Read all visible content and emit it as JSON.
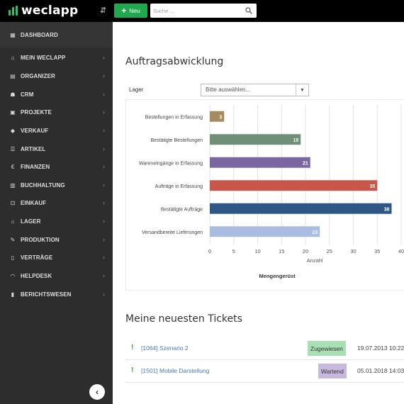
{
  "app": {
    "logo_text": "weclapp",
    "new_button_label": "Neu",
    "search_placeholder": "Suche ..."
  },
  "sidebar": {
    "items": [
      {
        "label": "DASHBOARD",
        "icon": "dashboard-icon",
        "has_chevron": false
      },
      {
        "label": "MEIN WECLAPP",
        "icon": "home-icon",
        "has_chevron": true
      },
      {
        "label": "ORGANIZER",
        "icon": "organizer-icon",
        "has_chevron": true
      },
      {
        "label": "CRM",
        "icon": "crm-icon",
        "has_chevron": true
      },
      {
        "label": "PROJEKTE",
        "icon": "briefcase-icon",
        "has_chevron": true
      },
      {
        "label": "VERKAUF",
        "icon": "tag-icon",
        "has_chevron": true
      },
      {
        "label": "ARTIKEL",
        "icon": "list-icon",
        "has_chevron": true
      },
      {
        "label": "FINANZEN",
        "icon": "euro-icon",
        "has_chevron": true
      },
      {
        "label": "BUCHHALTUNG",
        "icon": "calculator-icon",
        "has_chevron": true
      },
      {
        "label": "EINKAUF",
        "icon": "cart-icon",
        "has_chevron": true
      },
      {
        "label": "LAGER",
        "icon": "warehouse-icon",
        "has_chevron": true
      },
      {
        "label": "PRODUKTION",
        "icon": "wrench-icon",
        "has_chevron": true
      },
      {
        "label": "VERTRÄGE",
        "icon": "document-icon",
        "has_chevron": true
      },
      {
        "label": "HELPDESK",
        "icon": "headset-icon",
        "has_chevron": true
      },
      {
        "label": "BERICHTSWESEN",
        "icon": "bar-chart-icon",
        "has_chevron": true
      }
    ]
  },
  "order_processing": {
    "title": "Auftragsabwicklung",
    "lager_label": "Lager",
    "lager_select_value": "Bitte auswählen..."
  },
  "chart_data": {
    "type": "bar",
    "orientation": "horizontal",
    "categories": [
      "Bestellungen in Erfassung",
      "Bestätigte Bestellungen",
      "Wareneingänge in Erfassung",
      "Aufträge in Erfassung",
      "Bestätigte Aufträge",
      "Versandbereite Lieferungen"
    ],
    "values": [
      3,
      19,
      21,
      35,
      38,
      23
    ],
    "colors": [
      "#a48c62",
      "#6f8f76",
      "#7b67a0",
      "#c8564b",
      "#2f5785",
      "#a9bde0"
    ],
    "xticks": [
      0,
      5,
      10,
      15,
      20,
      25,
      30,
      35,
      40
    ],
    "xlim": [
      0,
      40
    ],
    "xlabel": "Anzahl",
    "title": "Mengengerüst",
    "grid": true,
    "data_labels": true
  },
  "tickets": {
    "title": "Meine neuesten Tickets",
    "items": [
      {
        "title": "[1064] Szenario 2",
        "status": "Zugewiesen",
        "status_color": "#a8e0b4",
        "date": "19.07.2013 10:22"
      },
      {
        "title": "[1501] Mobile Darstellung",
        "status": "Wartend",
        "status_color": "#c7b8dd",
        "date": "05.01.2018 14:03"
      }
    ]
  },
  "colors": {
    "topbar": "#000000",
    "sidebar": "#2d2d2d",
    "accent": "#1fa84d"
  }
}
